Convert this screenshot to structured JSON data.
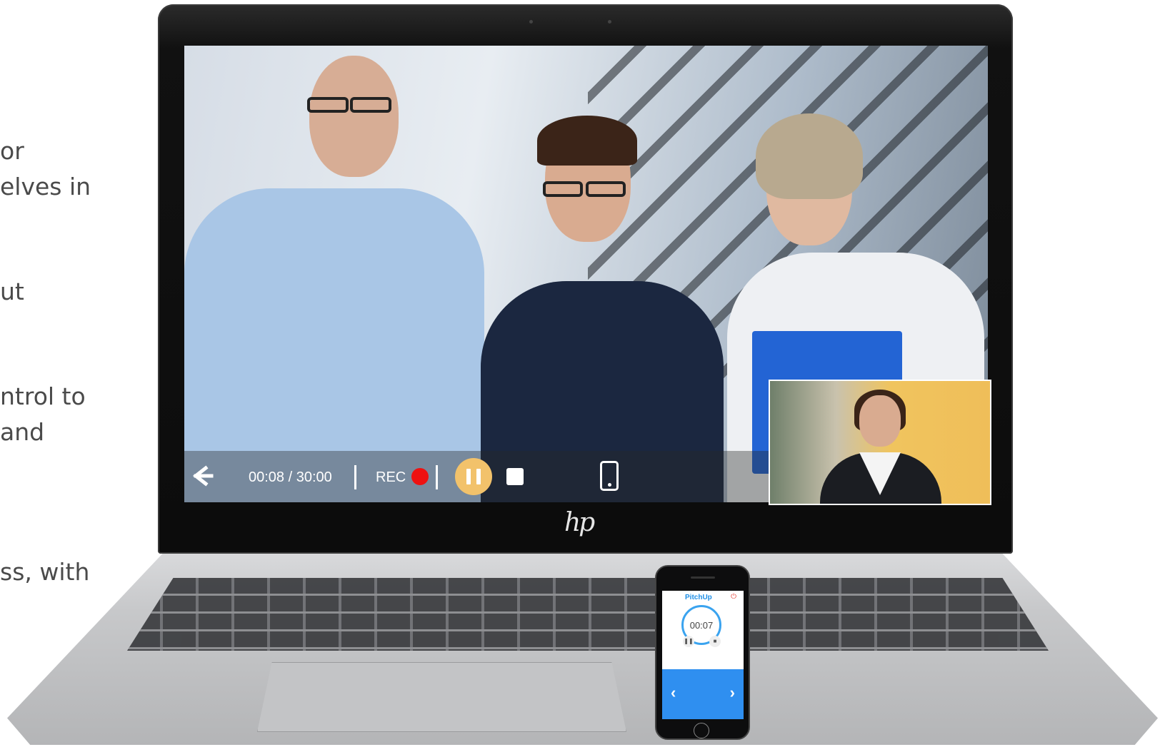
{
  "side_copy": [
    {
      "text": "or"
    },
    {
      "text": "elves in"
    },
    {
      "text": "ut"
    },
    {
      "text": "ntrol to"
    },
    {
      "text": "and"
    },
    {
      "text": "ss, with"
    }
  ],
  "player": {
    "time": "00:08 / 30:00",
    "rec_label": "REC",
    "icons": {
      "back": "arrow-left-icon",
      "record": "record-dot-icon",
      "pause": "pause-icon",
      "stop": "stop-icon",
      "phone": "smartphone-icon"
    },
    "colors": {
      "pause_bg": "#f2c26b",
      "rec_dot": "#ee1111"
    }
  },
  "laptop": {
    "brand": "hp"
  },
  "phone_app": {
    "logo": "PitchUp",
    "timer": "00:07",
    "accent": "#2f8ff0",
    "prev": "‹",
    "next": "›"
  }
}
